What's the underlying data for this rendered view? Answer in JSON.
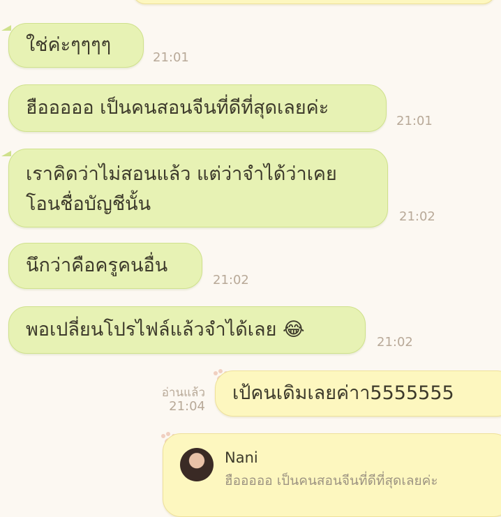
{
  "messages": [
    {
      "text": "ใช่ค่ะๆๆๆๆ",
      "time": "21:01"
    },
    {
      "text": "ฮือออออ เป็นคนสอนจีนที่ดีที่สุดเลยค่ะ",
      "time": "21:01"
    },
    {
      "line1": "เราคิดว่าไม่สอนแล้ว แต่ว่าจำได้ว่าเคย",
      "line2": "โอนชื่อบัญชีนั้น",
      "time": "21:02"
    },
    {
      "text": "นึกว่าคือครูคนอื่น",
      "time": "21:02"
    },
    {
      "text": "พอเปลี่ยนโปรไฟล์แล้วจำได้เลย 😂",
      "time": "21:02"
    }
  ],
  "outgoing": {
    "read_label": "อ่านแล้ว",
    "time": "21:04",
    "text": "เป้คนเดิมเลยค่าา5555555"
  },
  "reply": {
    "sender": "Nani",
    "quoted": "ฮือออออ เป็นคนสอนจีนที่ดีที่สุดเลยค่ะ"
  },
  "colors": {
    "incoming_bubble": "#e7f2b4",
    "outgoing_bubble": "#fdf7bf",
    "background": "#fcf8f2",
    "timestamp": "#b8a998"
  }
}
